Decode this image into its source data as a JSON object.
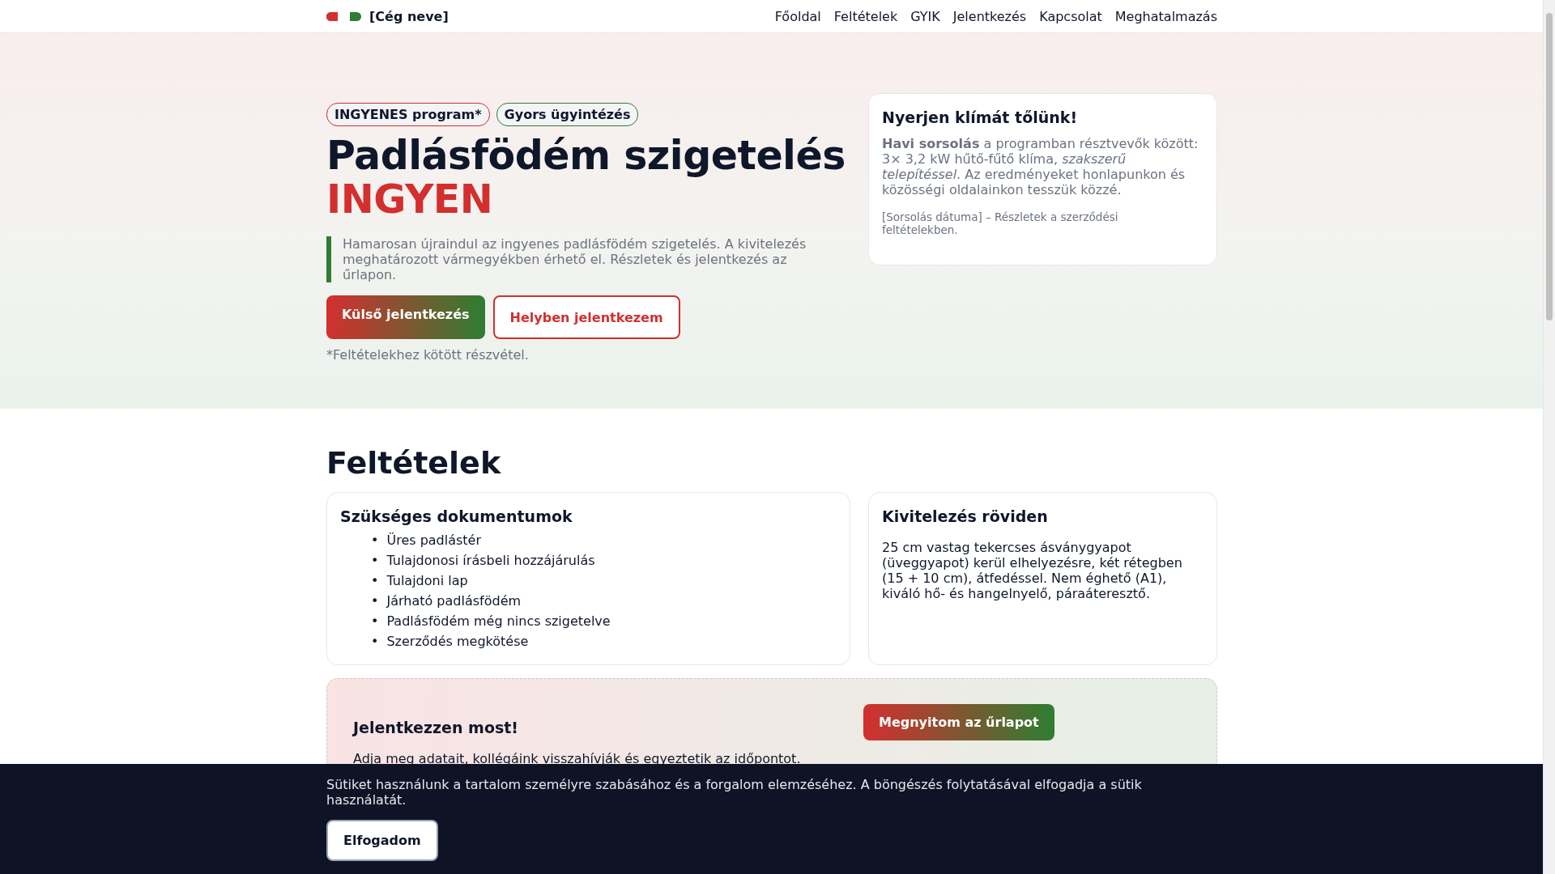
{
  "nav": {
    "brand": "[Cég neve]",
    "links": [
      "Főoldal",
      "Feltételek",
      "GYIK",
      "Jelentkezés",
      "Kapcsolat",
      "Meghatalmazás"
    ]
  },
  "hero": {
    "badges": [
      {
        "label": "INGYENES program*",
        "color": "#d32f2f"
      },
      {
        "label": "Gyors ügyintézés",
        "color": "#2e7d32"
      }
    ],
    "title": "Padlásfödém szigetelés",
    "title_highlight": "INGYEN",
    "lead": "Hamarosan újraindul az ingyenes padlásfödém szigetelés. A kivitelezés meghatározott vármegyékben érhető el. Részletek és jelentkezés az űrlapon.",
    "buttons": [
      {
        "label": "Külső jelentkezés",
        "kind": "gradient"
      },
      {
        "label": "Helyben jelentkezem",
        "kind": "outline"
      }
    ],
    "note": "*Feltételekhez kötött részvétel."
  },
  "prize_card": {
    "title": "Nyerjen klímát tőlünk!",
    "body": "**Havi sorsolás** a programban résztvevők között: 3× 3,2 kW hűtő-fűtő klíma, *szakszerű telepítéssel*. Az eredményeket honlapunkon és közösségi oldalainkon tesszük közzé.",
    "footnote": "[Sorsolás dátuma] – Részletek a szerződési feltételekben."
  },
  "conditions": {
    "title": "Feltételek",
    "documents": {
      "title": "Szükséges dokumentumok",
      "items": [
        {
          "marker": "•",
          "text": "Üres padlástér"
        },
        {
          "marker": "•",
          "text": "Tulajdonosi írásbeli hozzájárulás"
        },
        {
          "marker": "•",
          "text": "Tulajdoni lap"
        },
        {
          "marker": "•",
          "text": "Járható padlásfödém"
        },
        {
          "marker": "•",
          "text": "Padlásfödém még nincs szigetelve"
        },
        {
          "marker": "•",
          "text": "Szerződés megkötése"
        }
      ]
    },
    "summary": {
      "title": "Kivitelezés röviden",
      "text": "25 cm vastag tekercses ásványgyapot (üveggyapot) kerül elhelyezésre, két rétegben (15 + 10 cm), átfedéssel. Nem éghető (A1), kiváló hő- és hangelnyelő, páraáteresztő."
    }
  },
  "cta": {
    "title": "Jelentkezzen most!",
    "text": "Adja meg adatait, kollégáink visszahívják és egyeztetik az időpontot.",
    "button": "Megnyitom az űrlapot"
  },
  "cookie": {
    "text": "Sütiket használunk a tartalom személyre szabásához és a forgalom elemzéséhez. A böngészés folytatásával elfogadja a sütik használatát.",
    "button": "Elfogadom"
  }
}
